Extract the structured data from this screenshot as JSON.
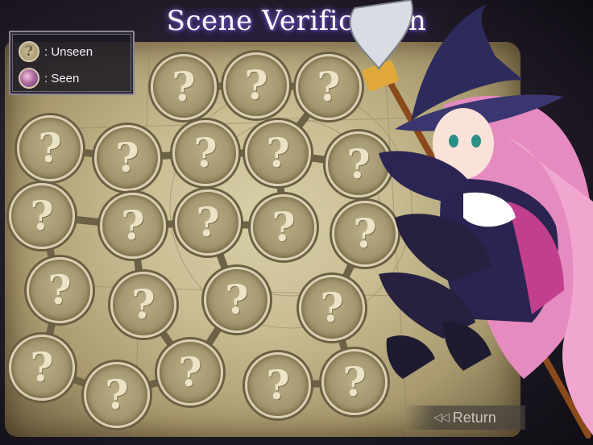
{
  "title": "Scene Verification",
  "legend": {
    "unseen_label": ": Unseen",
    "seen_label": ": Seen",
    "unseen_icon": "question-mark-icon",
    "seen_icon": "character-thumbnail-icon"
  },
  "scene_nodes": [
    {
      "label": "?",
      "state": "unseen"
    },
    {
      "label": "?",
      "state": "unseen"
    },
    {
      "label": "?",
      "state": "unseen"
    },
    {
      "label": "?",
      "state": "unseen"
    },
    {
      "label": "?",
      "state": "unseen"
    },
    {
      "label": "?",
      "state": "unseen"
    },
    {
      "label": "?",
      "state": "unseen"
    },
    {
      "label": "?",
      "state": "unseen"
    },
    {
      "label": "?",
      "state": "unseen"
    },
    {
      "label": "?",
      "state": "unseen"
    },
    {
      "label": "?",
      "state": "unseen"
    },
    {
      "label": "?",
      "state": "unseen"
    },
    {
      "label": "?",
      "state": "unseen"
    },
    {
      "label": "?",
      "state": "unseen"
    },
    {
      "label": "?",
      "state": "unseen"
    },
    {
      "label": "?",
      "state": "unseen"
    },
    {
      "label": "?",
      "state": "unseen"
    },
    {
      "label": "?",
      "state": "unseen"
    },
    {
      "label": "?",
      "state": "unseen"
    },
    {
      "label": "?",
      "state": "unseen"
    },
    {
      "label": "?",
      "state": "unseen"
    },
    {
      "label": "?",
      "state": "unseen"
    }
  ],
  "return_button": {
    "label": "Return",
    "icon": "return-arrows-icon"
  },
  "colors": {
    "title_glow": "#7b5cc9",
    "parchment": "#c9bd93",
    "node_fill": "#a2966f",
    "node_ring": "#d9cfb2"
  }
}
